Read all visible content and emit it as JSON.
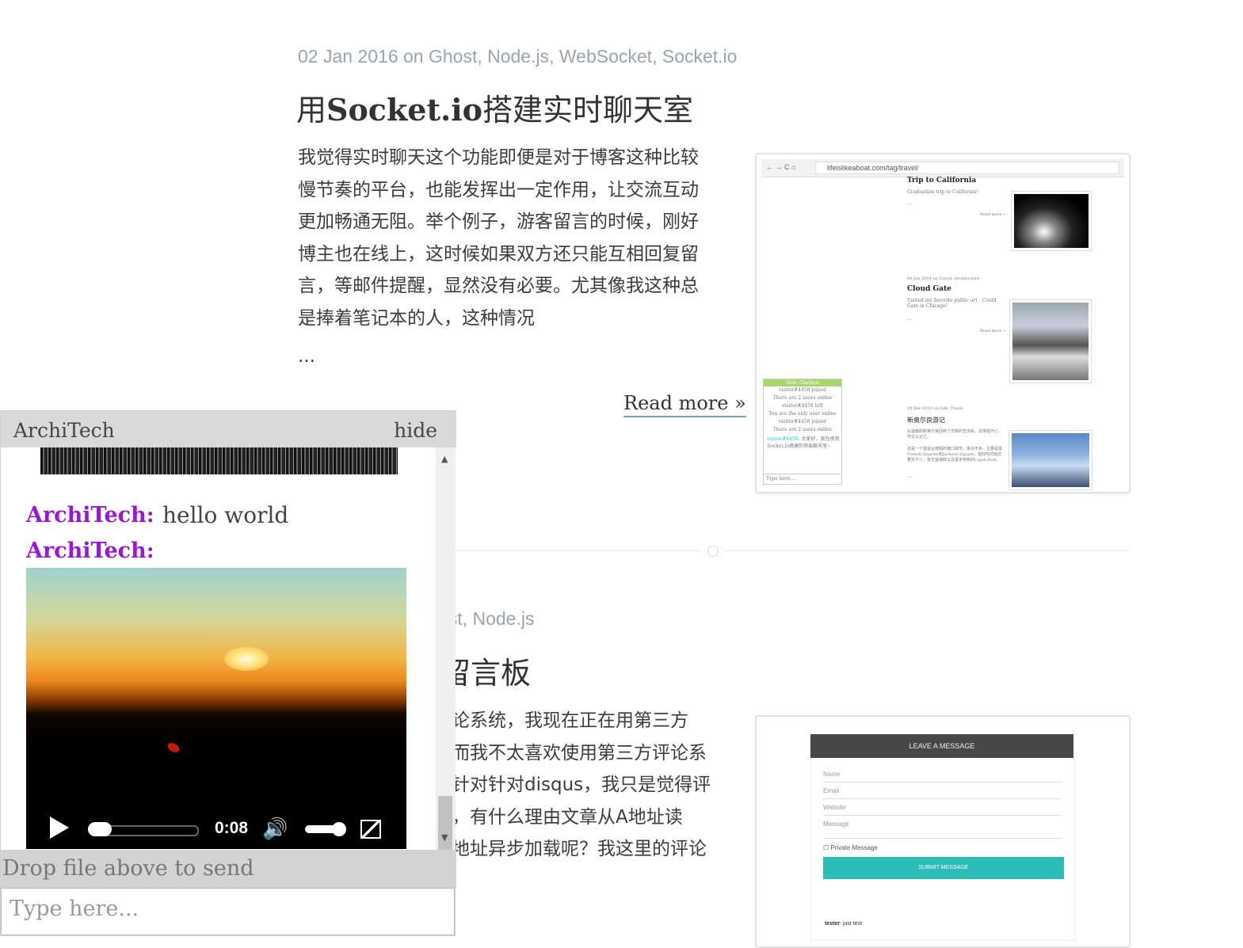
{
  "post1": {
    "meta": "02 Jan 2016 on Ghost, Node.js, WebSocket, Socket.io",
    "title_pre": "用",
    "title_bold": "Socket.io",
    "title_post": "搭建实时聊天室",
    "excerpt_lines": [
      "我觉得实时聊天这个功能即便是对于博客这种比较",
      "慢节奏的平台，也能发挥出一定作用，让交流互动",
      "更加畅通无阻。举个例子，游客留言的时候，刚好",
      "博主也在线上，这时候如果双方还只能互相回复留",
      "言，等邮件提醒，显然没有必要。尤其像我这种总",
      "是捧着笔记本的人，这种情况"
    ],
    "ellipsis": "...",
    "read_more": "Read more »",
    "screenshot": {
      "url": "lifeislikeaboat.com/tag/travel/",
      "nav_glyphs": "← → C ⌂",
      "post_a_title": "Trip to California",
      "post_a_desc": "Graduation trip to California!",
      "post_a_dots": "...",
      "read_more_small": "Read more »",
      "post_b_meta": "08 Jun 2014 on Travel, Architecture",
      "post_b_title": "Cloud Gate",
      "post_b_desc": "Visited my favorite public art - Could Gate in Chicago!",
      "post_b_dots": "...",
      "post_c_meta": "29 Dec 2012 on Life, Travel",
      "post_c_title": "新奥尔良游记",
      "post_c_desc_1": "从温暖的新奥尔良回到了日常的芝加哥，非常挺开心，作文以记之。",
      "post_c_desc_2": "这是一个很适合度假的港口城市，景点不多，主要是逛French Quarter和Jackson Square，但好吃的饭店着实不少，有生猛海鲜以及很多特色的Cajun food。",
      "post_c_dots": "...",
      "chat_lines": [
        "Hide Chatbox",
        "visitor#4458 joined",
        "There are 2 users online",
        "visitor#4458 left",
        "You are the only user online",
        "visitor#4458 joined",
        "There are 2 users online"
      ],
      "chat_msg_name": "visitor#4458:",
      "chat_msg_text": "大家好，我在使用Socket.io搭建的简易聊天室~",
      "chat_input_placeholder": "Type here..."
    }
  },
  "post2": {
    "meta": "ost, Node.js",
    "title": "留言板",
    "excerpt_lines": [
      "论系统，我现在正在用第三方",
      "而我不太喜欢使用第三方评论系",
      "针对针对disqus，我只是觉得评",
      "，有什么理由文章从A地址读",
      "地址异步加载呢？我这里的评论"
    ],
    "screenshot": {
      "form_title": "LEAVE A MESSAGE",
      "field_name": "Name",
      "field_email": "Email",
      "field_website": "Website",
      "field_message": "Message",
      "private_label": "Private Message",
      "submit_label": "SUBMIT MESSAGE",
      "comment_author": "tester",
      "comment_text": ": just test"
    }
  },
  "chat": {
    "title": "ArchiTech",
    "hide_label": "hide",
    "messages": [
      {
        "sender": "ArchiTech:",
        "text": "hello world"
      },
      {
        "sender": "ArchiTech:",
        "text": ""
      }
    ],
    "video_time": "0:08",
    "drop_label": "Drop file above to send",
    "input_placeholder": "Type here...",
    "colors": {
      "sender": "#9b17d8",
      "header_bg": "#d9d9d9",
      "drop_bg": "#d3d3d3"
    }
  }
}
